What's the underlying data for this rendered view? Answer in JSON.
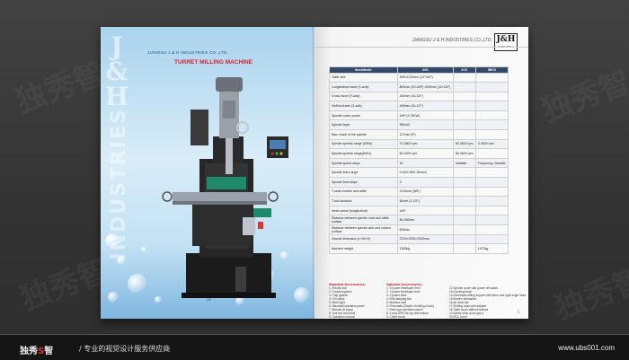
{
  "watermark": "独秀智",
  "left_page": {
    "brand_letters": [
      "J",
      "&",
      "H"
    ],
    "vertical_text": "INDUSTRIES",
    "company": "JIANGSU J & H INDUSTRIES CO.,LTD.",
    "title": "TURRET MILLING MACHINE",
    "model_tag": "2B"
  },
  "right_page": {
    "company": "JIANGSU J & H INDUSTRIES CO.,LTD.",
    "logo_main": "J&H",
    "logo_sub": "Industries",
    "table": {
      "headers": [
        "Item/Model",
        "3VS",
        "4VS",
        "5BVS"
      ],
      "rows": [
        [
          "Table size",
          "305×1370mm (12″×54″)",
          "",
          ""
        ],
        [
          "Longitudinal travel (X-axis)",
          "800mm (3X-54P) 1000mm (12×11P)",
          "",
          ""
        ],
        [
          "Cross travel (Y-axis)",
          "440mm (16-3/4″)",
          "",
          ""
        ],
        [
          "Vertical travel (Z-axis)",
          "440mm (16-1/2″)",
          "",
          ""
        ],
        [
          "Spindle motor power",
          "4HP (3.75KW)",
          "",
          ""
        ],
        [
          "Spindle taper",
          "R8/#40",
          "",
          ""
        ],
        [
          "Max. travel of the spindle",
          "127mm (5″)",
          "",
          ""
        ],
        [
          "Spindle speeds range (50Hz)",
          "70-3600 rpm",
          "80-3600 rpm",
          "0-4000 rpm"
        ],
        [
          "Spindle speeds range(60Hz)",
          "60-4200 rpm",
          "80-3600 rpm",
          ""
        ],
        [
          "Spindle speed steps",
          "16",
          "Variable",
          "Frequency, Variable"
        ],
        [
          "Spindle feed range",
          "0.04/0.08/0.15mm/r",
          "",
          ""
        ],
        [
          "Spindle feed steps",
          "3",
          "",
          ""
        ],
        [
          "T-slots number and width",
          "3×16mm (5/8″)",
          "",
          ""
        ],
        [
          "T-slot distance",
          "64mm (2-1/2″)",
          "",
          ""
        ],
        [
          "Head swivel (longitudinal)",
          "±90°",
          "",
          ""
        ],
        [
          "Distance between spindle nose and table surface",
          "80-530mm",
          "",
          ""
        ],
        [
          "Distance between spindle axis and column surface",
          "600mm",
          "",
          ""
        ],
        [
          "Overall dimension (L×W×H)",
          "2700×2030×2340mm",
          "",
          ""
        ],
        [
          "Machine weight",
          "1950kg",
          "",
          "1970kg"
        ]
      ]
    },
    "standard_accessories": {
      "title": "Standard Accessories:",
      "items": [
        "1. Electric box",
        "2. Coolant system",
        "3. Chip guards",
        "4. Oil collect",
        "5. Work light",
        "6. Standard operation panel",
        "7. Manual oil pump",
        "8. Tool box and tools",
        "9. Operation manual",
        "10.Draw bar"
      ]
    },
    "optional_accessories": {
      "title": "Optional Accessories:",
      "items": [
        "1. X power feed/taper feed",
        "2. Y power feed/taper feed",
        "3. Z power feed",
        "4. R/8 clamping kits",
        "5. Machine vise",
        "6. Pneumatic (Depth of milling chuck)",
        "7. Rear-type operation panel",
        "8. 3-axis DRO for top and bottom",
        "9. Collet chuck",
        "10.DRO (3 axes/5 axes)",
        "11.Rotary table"
      ]
    },
    "more_accessories": {
      "items": [
        "12.Spindle cover with power off switch",
        "13.Clocking head",
        "14.Horizontal milling support with arbor and right angle head",
        "15.Electric lubrication",
        "16.Air draw bar",
        "17.Slotting head with adapter",
        "18.Table cover without bellows",
        "19.Safety shop door type A",
        "20.PDC cover"
      ]
    },
    "page_number": "3"
  },
  "footer": {
    "logo_left": "独秀",
    "logo_mid": "S",
    "logo_right": "智",
    "slogan": "/ 专业的视觉设计服务供应商",
    "url": "www.ubs001.com"
  }
}
